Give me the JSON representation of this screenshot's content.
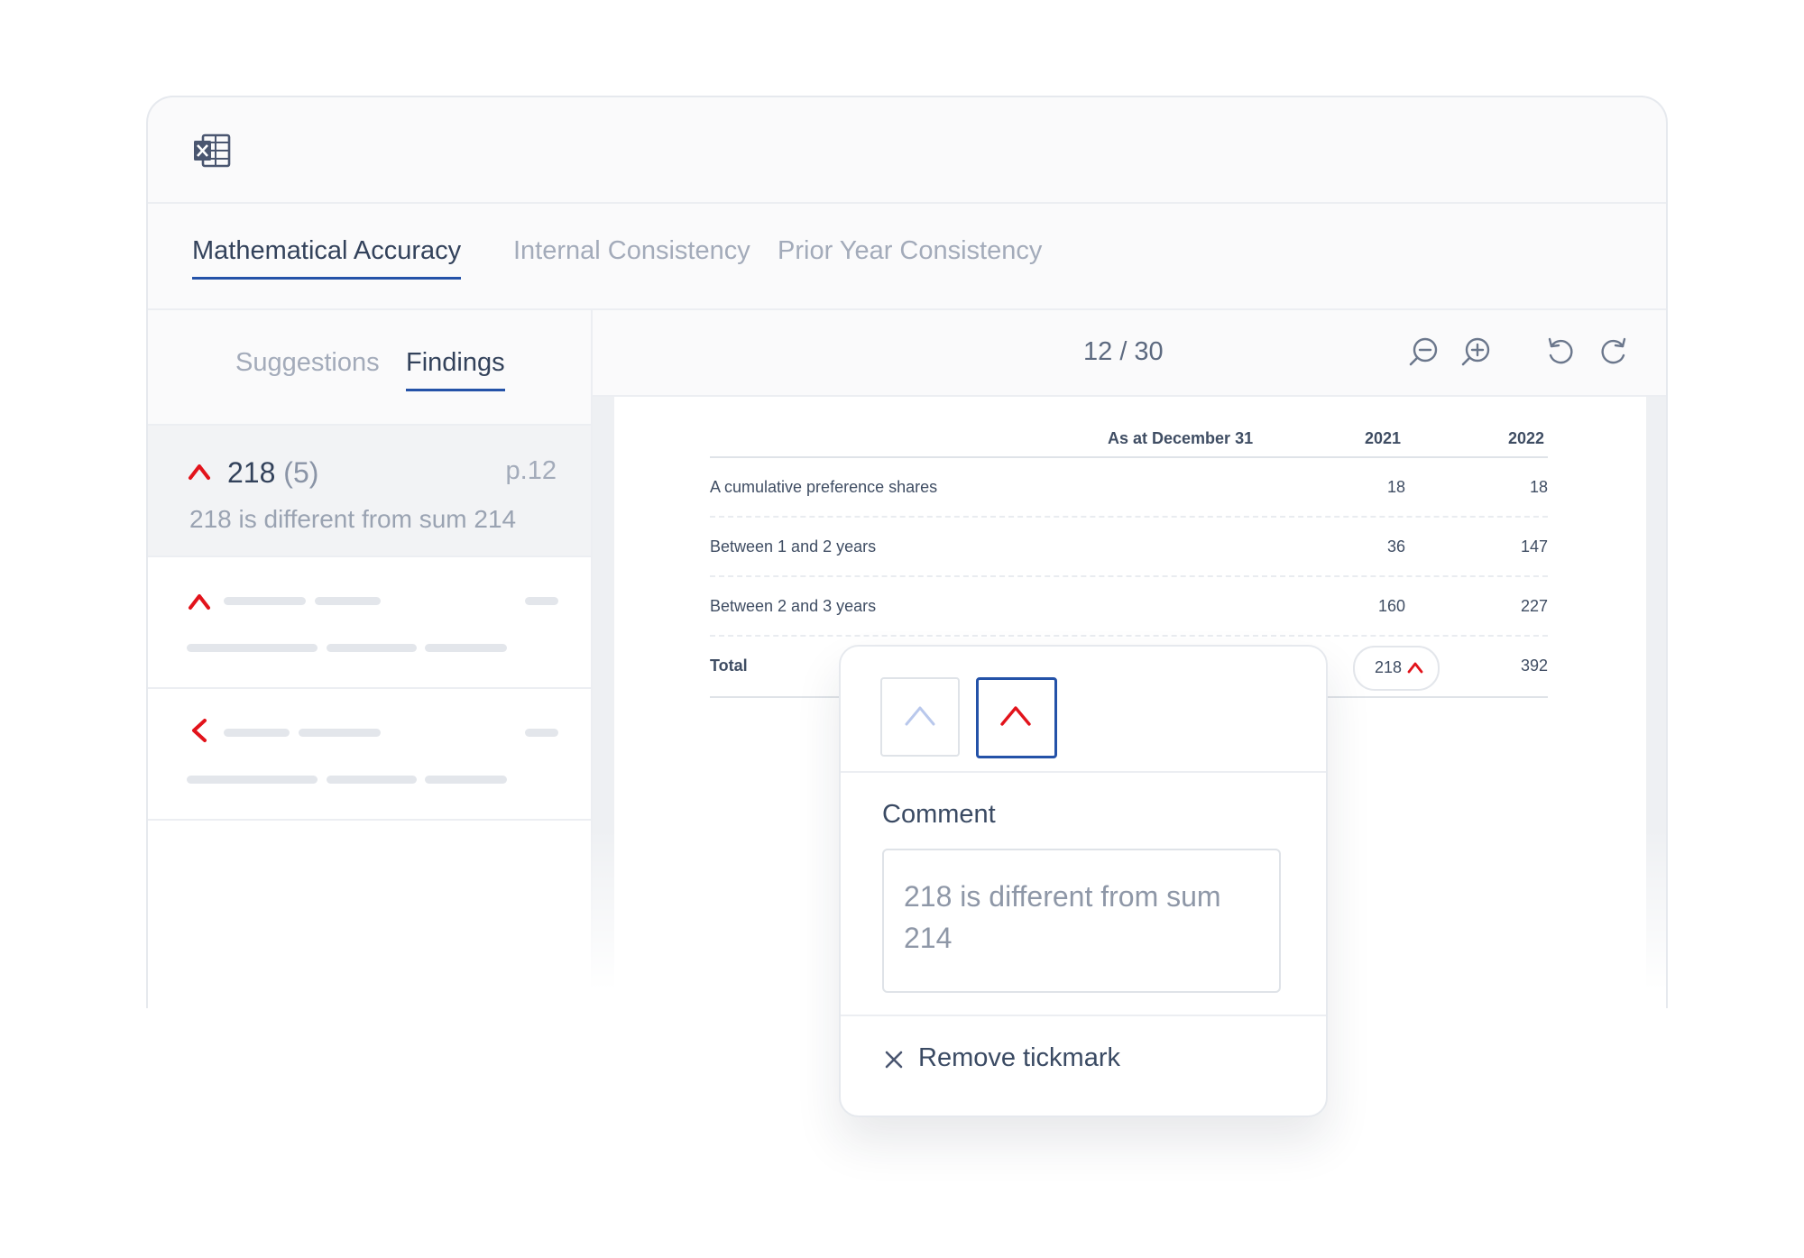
{
  "tabs": [
    {
      "label": "Mathematical Accuracy",
      "active": true
    },
    {
      "label": "Internal Consistency",
      "active": false
    },
    {
      "label": "Prior Year Consistency",
      "active": false
    }
  ],
  "subtabs": [
    {
      "label": "Suggestions",
      "active": false
    },
    {
      "label": "Findings",
      "active": true
    }
  ],
  "findings": [
    {
      "value": "218",
      "count": "(5)",
      "page": "p.12",
      "description": "218 is different from sum 214",
      "icon": "caret-up-icon",
      "icon_color": "#e2131b"
    }
  ],
  "viewer": {
    "page_indicator": "12 / 30",
    "icons": [
      "zoom-out-icon",
      "zoom-in-icon",
      "rotate-left-icon",
      "rotate-right-icon"
    ]
  },
  "table": {
    "headers": [
      "As at December 31",
      "2021",
      "2022"
    ],
    "rows": [
      {
        "label": "A cumulative preference shares",
        "v2021": "18",
        "v2022": "18"
      },
      {
        "label": "Between 1 and 2 years",
        "v2021": "36",
        "v2022": "147"
      },
      {
        "label": "Between 2 and 3 years",
        "v2021": "160",
        "v2022": "227"
      },
      {
        "label": "Total",
        "v2021": "218",
        "v2022": "392"
      }
    ]
  },
  "popup": {
    "comment_label": "Comment",
    "comment_text": "218 is different from sum 214",
    "remove_label": "Remove tickmark"
  },
  "colors": {
    "accent": "#2452a8",
    "error": "#e2131b",
    "muted_tick": "#b9c8ec"
  }
}
